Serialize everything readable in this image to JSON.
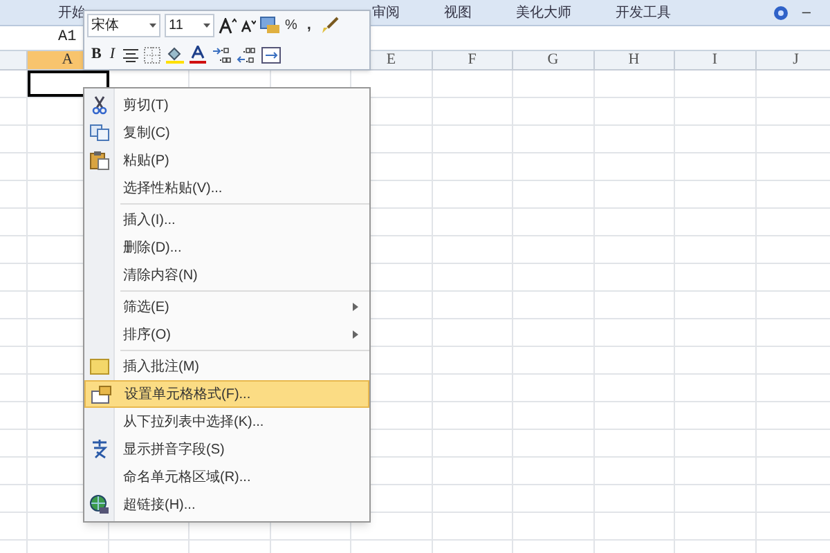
{
  "ribbon": {
    "tabs": [
      {
        "label": "开始",
        "selected": false
      },
      {
        "label": "审阅",
        "selected": false
      },
      {
        "label": "视图",
        "selected": false
      },
      {
        "label": "美化大师",
        "selected": false
      },
      {
        "label": "开发工具",
        "selected": false
      }
    ],
    "minimize": "–"
  },
  "name_box": {
    "value": "A1"
  },
  "columns": [
    {
      "label": "A",
      "selected": true
    },
    {
      "label": "E",
      "selected": false
    },
    {
      "label": "F",
      "selected": false
    },
    {
      "label": "G",
      "selected": false
    },
    {
      "label": "H",
      "selected": false
    },
    {
      "label": "I",
      "selected": false
    },
    {
      "label": "J",
      "selected": false
    }
  ],
  "mini_toolbar": {
    "font": "宋体",
    "size": "11",
    "percent": "%",
    "comma": ",",
    "bold": "B",
    "italic": "I"
  },
  "context_menu": {
    "groups": [
      {
        "items": [
          {
            "label": "剪切(T)",
            "selected": false,
            "submenu": false
          },
          {
            "label": "复制(C)",
            "selected": false,
            "submenu": false
          },
          {
            "label": "粘贴(P)",
            "selected": false,
            "submenu": false
          },
          {
            "label": "选择性粘贴(V)...",
            "selected": false,
            "submenu": false
          }
        ]
      },
      {
        "items": [
          {
            "label": "插入(I)...",
            "selected": false,
            "submenu": false
          },
          {
            "label": "删除(D)...",
            "selected": false,
            "submenu": false
          },
          {
            "label": "清除内容(N)",
            "selected": false,
            "submenu": false
          }
        ]
      },
      {
        "items": [
          {
            "label": "筛选(E)",
            "selected": false,
            "submenu": true
          },
          {
            "label": "排序(O)",
            "selected": false,
            "submenu": true
          }
        ]
      },
      {
        "items": [
          {
            "label": "插入批注(M)",
            "selected": false,
            "submenu": false
          },
          {
            "label": "设置单元格格式(F)...",
            "selected": true,
            "submenu": false
          },
          {
            "label": "从下拉列表中选择(K)...",
            "selected": false,
            "submenu": false
          },
          {
            "label": "显示拼音字段(S)",
            "selected": false,
            "submenu": false
          },
          {
            "label": "命名单元格区域(R)...",
            "selected": false,
            "submenu": false
          },
          {
            "label": "超链接(H)...",
            "selected": false,
            "submenu": false
          }
        ]
      }
    ]
  }
}
